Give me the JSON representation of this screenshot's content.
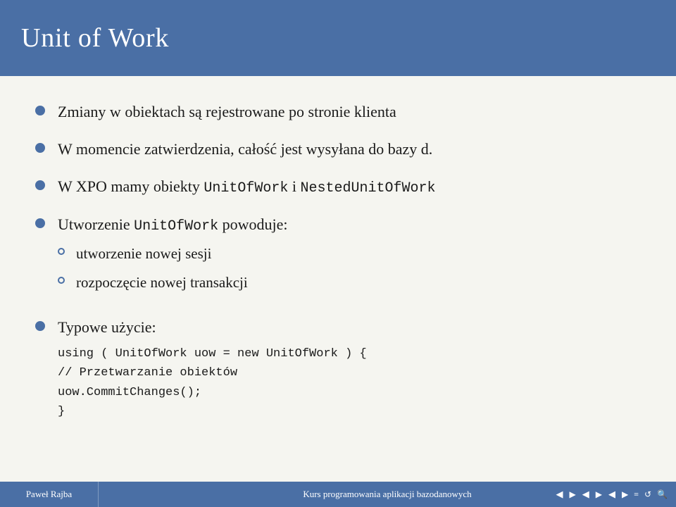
{
  "header": {
    "title": "Unit of Work",
    "background": "#4a6fa5"
  },
  "content": {
    "bullets": [
      {
        "id": "bullet1",
        "text": "Zmiany w obiektach są rejestrowane po stronie klienta",
        "sub": []
      },
      {
        "id": "bullet2",
        "text": "W momencie zatwierdzenia, całość jest wysyłana do bazy d.",
        "sub": []
      },
      {
        "id": "bullet3",
        "text_prefix": "W XPO mamy obiekty ",
        "code1": "UnitOfWork",
        "text_middle": " i ",
        "code2": "NestedUnitOfWork",
        "sub": []
      },
      {
        "id": "bullet4",
        "text_prefix": "Utworzenie ",
        "code1": "UnitOfWork",
        "text_suffix": " powoduje:",
        "sub": [
          {
            "text": "utworzenie nowej sesji"
          },
          {
            "text": "rozpoczęcie nowej transakcji"
          }
        ]
      },
      {
        "id": "bullet5",
        "text": "Typowe użycie:",
        "sub": []
      }
    ],
    "code_block": {
      "lines": [
        "using ( UnitOfWork uow = new UnitOfWork ) {",
        "    // Przetwarzanie obiektów",
        "    uow.CommitChanges();",
        "}"
      ]
    }
  },
  "footer": {
    "author": "Paweł Rajba",
    "course": "Kurs programowania aplikacji bazodanowych"
  }
}
